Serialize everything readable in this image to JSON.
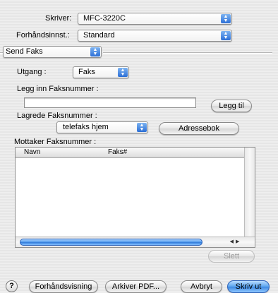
{
  "printer": {
    "label": "Skriver:",
    "value": "MFC-3220C"
  },
  "presets": {
    "label": "Forhåndsinnst.:",
    "value": "Standard"
  },
  "panel": {
    "value": "Send Faks"
  },
  "output": {
    "label": "Utgang :",
    "value": "Faks"
  },
  "fax_entry": {
    "label": "Legg inn Faksnummer :",
    "value": "",
    "add_button": "Legg til"
  },
  "stored": {
    "label": "Lagrede Faksnummer :",
    "value": "telefaks hjem",
    "address_book_button": "Adressebok"
  },
  "recipients": {
    "label": "Mottaker Faksnummer :",
    "columns": [
      "Navn",
      "Faks#"
    ],
    "rows": [],
    "delete_button": "Slett"
  },
  "footer": {
    "help": "?",
    "preview": "Forhåndsvisning",
    "save_pdf": "Arkiver PDF...",
    "cancel": "Avbryt",
    "print": "Skriv ut"
  }
}
